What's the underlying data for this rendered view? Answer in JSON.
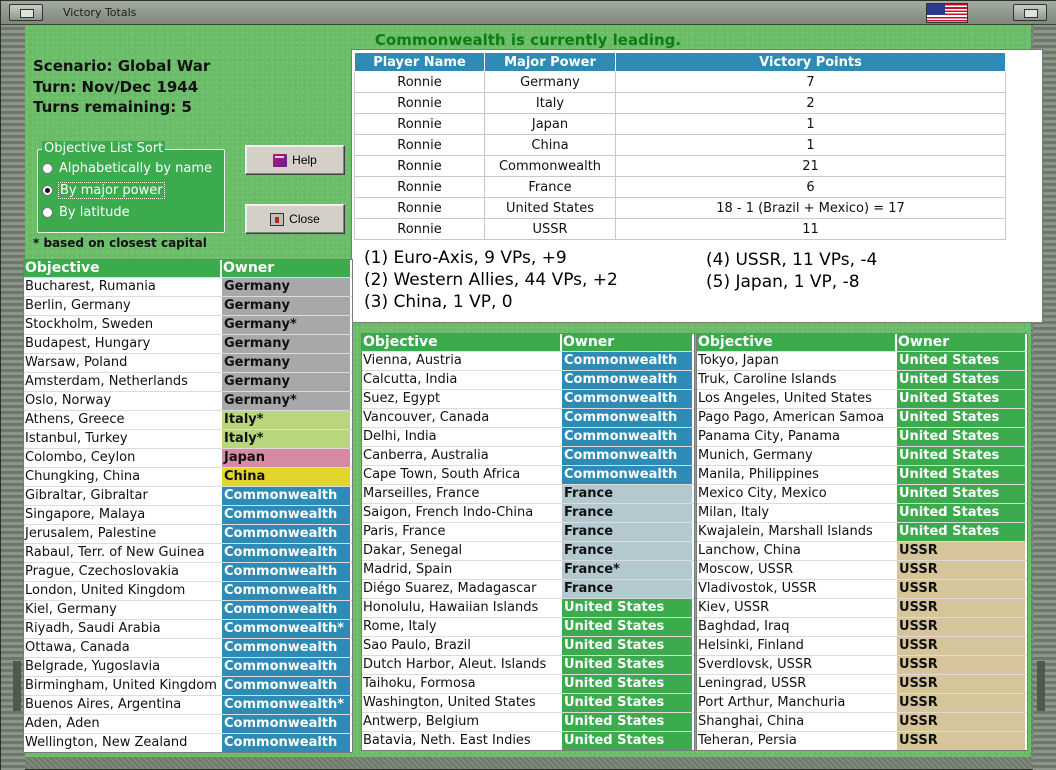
{
  "window": {
    "title": "Victory Totals",
    "flag_icon": "us-flag-icon"
  },
  "status": "Commonwealth is currently leading.",
  "scenario": {
    "scenario_line": "Scenario: Global War",
    "turn_line": "Turn: Nov/Dec 1944",
    "remaining_line": "Turns remaining: 5"
  },
  "sort": {
    "legend": "Objective List Sort",
    "options": [
      "Alphabetically by name",
      "By major power",
      "By latitude"
    ],
    "selected": "By major power",
    "note": "* based on closest capital"
  },
  "buttons": {
    "help": "Help",
    "close": "Close"
  },
  "vp_table": {
    "headers": [
      "Player Name",
      "Major Power",
      "Victory Points"
    ],
    "rows": [
      [
        "Ronnie",
        "Germany",
        "7"
      ],
      [
        "Ronnie",
        "Italy",
        "2"
      ],
      [
        "Ronnie",
        "Japan",
        "1"
      ],
      [
        "Ronnie",
        "China",
        "1"
      ],
      [
        "Ronnie",
        "Commonwealth",
        "21"
      ],
      [
        "Ronnie",
        "France",
        "6"
      ],
      [
        "Ronnie",
        "United States",
        "18 - 1 (Brazil + Mexico) = 17"
      ],
      [
        "Ronnie",
        "USSR",
        "11"
      ]
    ]
  },
  "alliance_summary": [
    "(1)  Euro-Axis, 9 VPs, +9",
    "(2)  Western Allies, 44 VPs, +2",
    "(3)  China, 1 VP, 0",
    "(4)  USSR, 11 VPs, -4",
    "(5)  Japan, 1 VP, -8"
  ],
  "colors": {
    "Germany": "#a8a8a8",
    "Italy": "#b8d77c",
    "Japan": "#d78aa6",
    "China": "#e0d62c",
    "Commonwealth": "#2e8bb6",
    "France": "#b4c8d0",
    "United States": "#3cab4e",
    "USSR": "#d6c59a"
  },
  "objective_lists": [
    {
      "headers": [
        "Objective",
        "Owner"
      ],
      "rows": [
        [
          "Bucharest, Rumania",
          "Germany",
          "Germany"
        ],
        [
          "Berlin, Germany",
          "Germany",
          "Germany"
        ],
        [
          "Stockholm, Sweden",
          "Germany*",
          "Germany"
        ],
        [
          "Budapest, Hungary",
          "Germany",
          "Germany"
        ],
        [
          "Warsaw, Poland",
          "Germany",
          "Germany"
        ],
        [
          "Amsterdam, Netherlands",
          "Germany",
          "Germany"
        ],
        [
          "Oslo, Norway",
          "Germany*",
          "Germany"
        ],
        [
          "Athens, Greece",
          "Italy*",
          "Italy"
        ],
        [
          "Istanbul, Turkey",
          "Italy*",
          "Italy"
        ],
        [
          "Colombo, Ceylon",
          "Japan",
          "Japan"
        ],
        [
          "Chungking, China",
          "China",
          "China"
        ],
        [
          "Gibraltar, Gibraltar",
          "Commonwealth",
          "Commonwealth"
        ],
        [
          "Singapore, Malaya",
          "Commonwealth",
          "Commonwealth"
        ],
        [
          "Jerusalem, Palestine",
          "Commonwealth",
          "Commonwealth"
        ],
        [
          "Rabaul, Terr. of New Guinea",
          "Commonwealth",
          "Commonwealth"
        ],
        [
          "Prague, Czechoslovakia",
          "Commonwealth",
          "Commonwealth"
        ],
        [
          "London, United Kingdom",
          "Commonwealth",
          "Commonwealth"
        ],
        [
          "Kiel, Germany",
          "Commonwealth",
          "Commonwealth"
        ],
        [
          "Riyadh, Saudi Arabia",
          "Commonwealth*",
          "Commonwealth"
        ],
        [
          "Ottawa, Canada",
          "Commonwealth",
          "Commonwealth"
        ],
        [
          "Belgrade, Yugoslavia",
          "Commonwealth",
          "Commonwealth"
        ],
        [
          "Birmingham, United Kingdom",
          "Commonwealth",
          "Commonwealth"
        ],
        [
          "Buenos Aires, Argentina",
          "Commonwealth*",
          "Commonwealth"
        ],
        [
          "Aden, Aden",
          "Commonwealth",
          "Commonwealth"
        ],
        [
          "Wellington, New Zealand",
          "Commonwealth",
          "Commonwealth"
        ]
      ]
    },
    {
      "headers": [
        "Objective",
        "Owner"
      ],
      "rows": [
        [
          "Vienna, Austria",
          "Commonwealth",
          "Commonwealth"
        ],
        [
          "Calcutta, India",
          "Commonwealth",
          "Commonwealth"
        ],
        [
          "Suez, Egypt",
          "Commonwealth",
          "Commonwealth"
        ],
        [
          "Vancouver, Canada",
          "Commonwealth",
          "Commonwealth"
        ],
        [
          "Delhi, India",
          "Commonwealth",
          "Commonwealth"
        ],
        [
          "Canberra, Australia",
          "Commonwealth",
          "Commonwealth"
        ],
        [
          "Cape Town, South Africa",
          "Commonwealth",
          "Commonwealth"
        ],
        [
          "Marseilles, France",
          "France",
          "France"
        ],
        [
          "Saigon, French Indo-China",
          "France",
          "France"
        ],
        [
          "Paris, France",
          "France",
          "France"
        ],
        [
          "Dakar, Senegal",
          "France",
          "France"
        ],
        [
          "Madrid, Spain",
          "France*",
          "France"
        ],
        [
          "Diégo Suarez, Madagascar",
          "France",
          "France"
        ],
        [
          "Honolulu, Hawaiian Islands",
          "United States",
          "United States"
        ],
        [
          "Rome, Italy",
          "United States",
          "United States"
        ],
        [
          "Sao Paulo, Brazil",
          "United States",
          "United States"
        ],
        [
          "Dutch Harbor, Aleut. Islands",
          "United States",
          "United States"
        ],
        [
          "Taihoku, Formosa",
          "United States",
          "United States"
        ],
        [
          "Washington, United States",
          "United States",
          "United States"
        ],
        [
          "Antwerp, Belgium",
          "United States",
          "United States"
        ],
        [
          "Batavia, Neth. East Indies",
          "United States",
          "United States"
        ]
      ]
    },
    {
      "headers": [
        "Objective",
        "Owner"
      ],
      "rows": [
        [
          "Tokyo, Japan",
          "United States",
          "United States"
        ],
        [
          "Truk, Caroline Islands",
          "United States",
          "United States"
        ],
        [
          "Los Angeles, United States",
          "United States",
          "United States"
        ],
        [
          "Pago Pago, American Samoa",
          "United States",
          "United States"
        ],
        [
          "Panama City, Panama",
          "United States",
          "United States"
        ],
        [
          "Munich, Germany",
          "United States",
          "United States"
        ],
        [
          "Manila, Philippines",
          "United States",
          "United States"
        ],
        [
          "Mexico City, Mexico",
          "United States",
          "United States"
        ],
        [
          "Milan, Italy",
          "United States",
          "United States"
        ],
        [
          "Kwajalein, Marshall Islands",
          "United States",
          "United States"
        ],
        [
          "Lanchow, China",
          "USSR",
          "USSR"
        ],
        [
          "Moscow, USSR",
          "USSR",
          "USSR"
        ],
        [
          "Vladivostok, USSR",
          "USSR",
          "USSR"
        ],
        [
          "Kiev, USSR",
          "USSR",
          "USSR"
        ],
        [
          "Baghdad, Iraq",
          "USSR",
          "USSR"
        ],
        [
          "Helsinki, Finland",
          "USSR",
          "USSR"
        ],
        [
          "Sverdlovsk, USSR",
          "USSR",
          "USSR"
        ],
        [
          "Leningrad, USSR",
          "USSR",
          "USSR"
        ],
        [
          "Port Arthur, Manchuria",
          "USSR",
          "USSR"
        ],
        [
          "Shanghai, China",
          "USSR",
          "USSR"
        ],
        [
          "Teheran, Persia",
          "USSR",
          "USSR"
        ]
      ]
    }
  ]
}
